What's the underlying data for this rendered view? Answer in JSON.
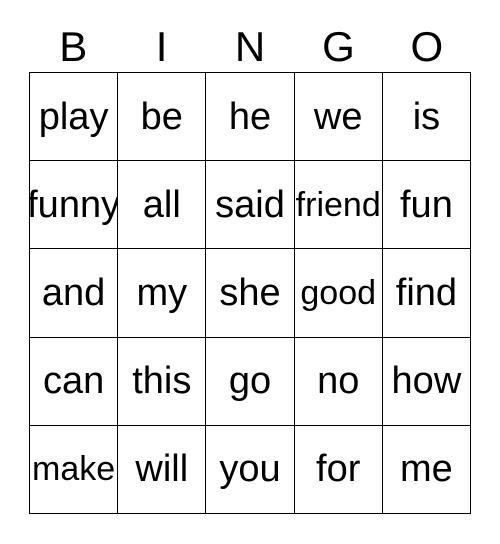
{
  "card": {
    "headers": [
      "B",
      "I",
      "N",
      "G",
      "O"
    ],
    "rows": [
      [
        "play",
        "be",
        "he",
        "we",
        "is"
      ],
      [
        "funny",
        "all",
        "said",
        "friend",
        "fun"
      ],
      [
        "and",
        "my",
        "she",
        "good",
        "find"
      ],
      [
        "can",
        "this",
        "go",
        "no",
        "how"
      ],
      [
        "make",
        "will",
        "you",
        "for",
        "me"
      ]
    ],
    "colors": {
      "border": "#000000",
      "text": "#000000",
      "background": "#ffffff"
    }
  }
}
